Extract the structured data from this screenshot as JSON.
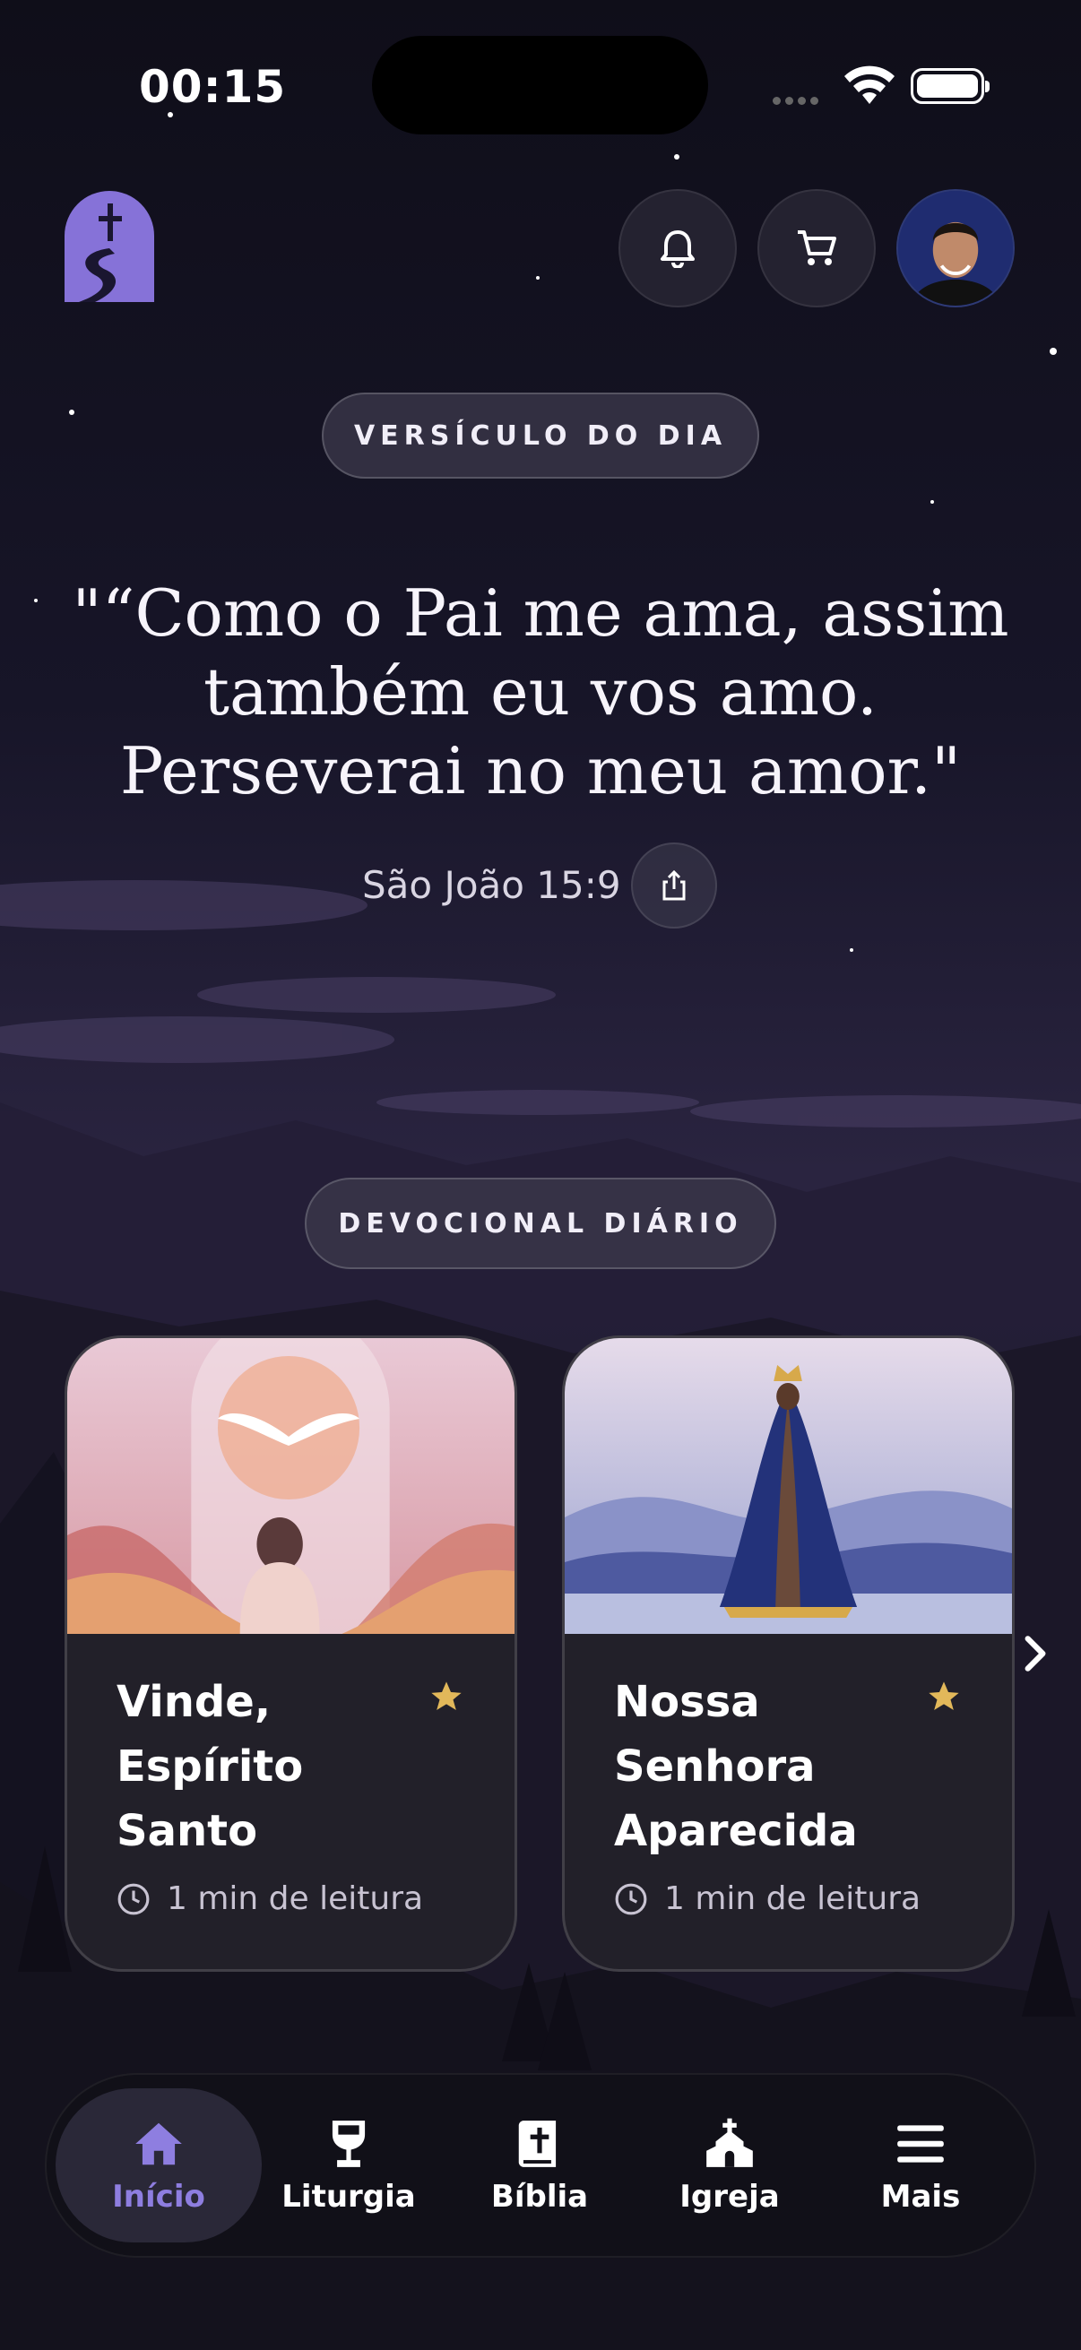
{
  "status": {
    "time": "00:15"
  },
  "verse": {
    "label": "VERSÍCULO DO DIA",
    "text": "\"“Como o Pai me ama, assim também eu vos amo. Perseverai no meu amor.\"",
    "reference": "São João 15:9"
  },
  "devotional": {
    "label": "DEVOCIONAL DIÁRIO",
    "cards": [
      {
        "title": "Vinde, Espírito Santo",
        "read_time": "1 min de leitura"
      },
      {
        "title": "Nossa Senhora Aparecida",
        "read_time": "1 min de leitura"
      }
    ]
  },
  "nav": {
    "items": [
      {
        "label": "Início",
        "icon": "home-icon",
        "active": true
      },
      {
        "label": "Liturgia",
        "icon": "chalice-icon",
        "active": false
      },
      {
        "label": "Bíblia",
        "icon": "bible-icon",
        "active": false
      },
      {
        "label": "Igreja",
        "icon": "church-icon",
        "active": false
      },
      {
        "label": "Mais",
        "icon": "menu-icon",
        "active": false
      }
    ]
  },
  "colors": {
    "accent": "#8e7ee0",
    "star": "#e2b85a",
    "background": "#100f1c"
  }
}
